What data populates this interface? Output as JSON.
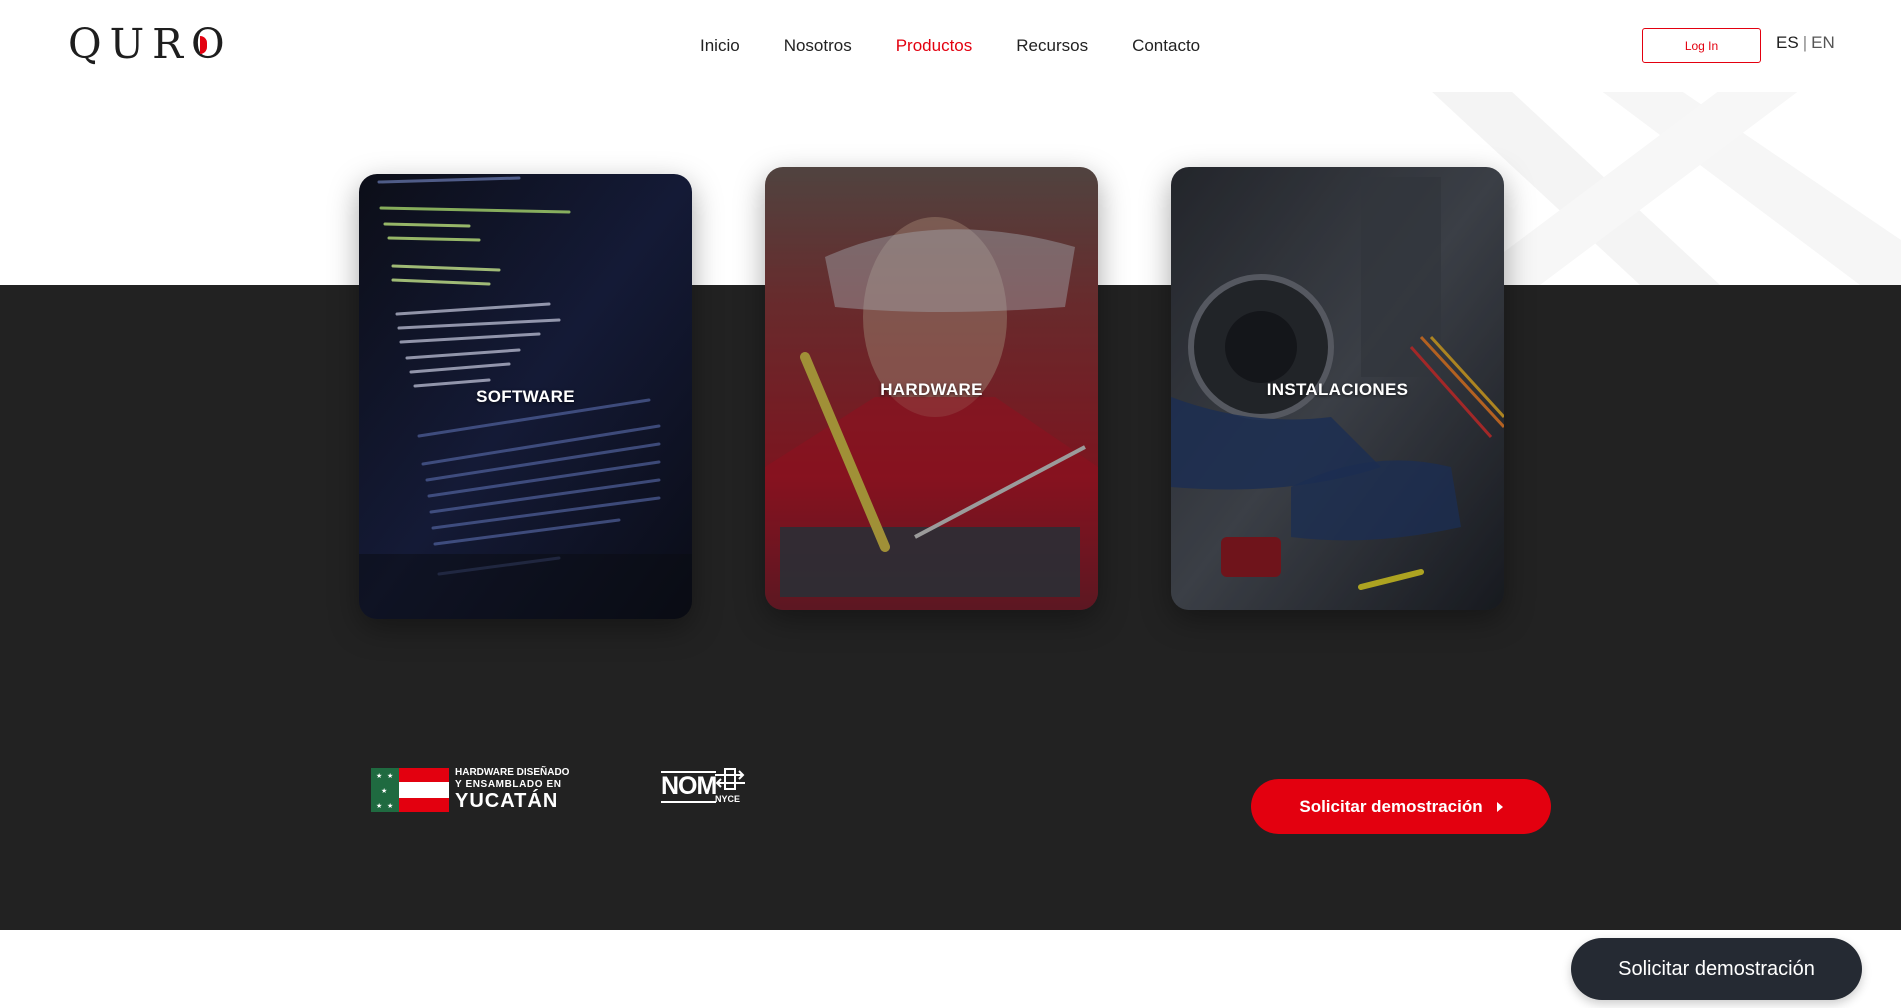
{
  "header": {
    "logo_text": "QURO",
    "nav": [
      {
        "label": "Inicio",
        "active": false
      },
      {
        "label": "Nosotros",
        "active": false
      },
      {
        "label": "Productos",
        "active": true
      },
      {
        "label": "Recursos",
        "active": false
      },
      {
        "label": "Contacto",
        "active": false
      }
    ],
    "login_label": "Log In",
    "lang_active": "ES",
    "lang_separator": "|",
    "lang_inactive": "EN"
  },
  "cards": [
    {
      "title": "SOFTWARE",
      "image": "code-screen"
    },
    {
      "title": "HARDWARE",
      "image": "technician-soldering"
    },
    {
      "title": "INSTALACIONES",
      "image": "vehicle-installation"
    }
  ],
  "badges": {
    "yucatan_line1": "HARDWARE DISEÑADO",
    "yucatan_line2": "Y ENSAMBLADO EN",
    "yucatan_line3": "YUCATÁN",
    "nom_text": "NOM",
    "nyce_text": "NYCE"
  },
  "cta": {
    "demo_label": "Solicitar demostración",
    "floating_label": "Solicitar demostración"
  },
  "colors": {
    "accent": "#e3000f",
    "dark_band": "#222222",
    "floating_button": "#252a33"
  }
}
